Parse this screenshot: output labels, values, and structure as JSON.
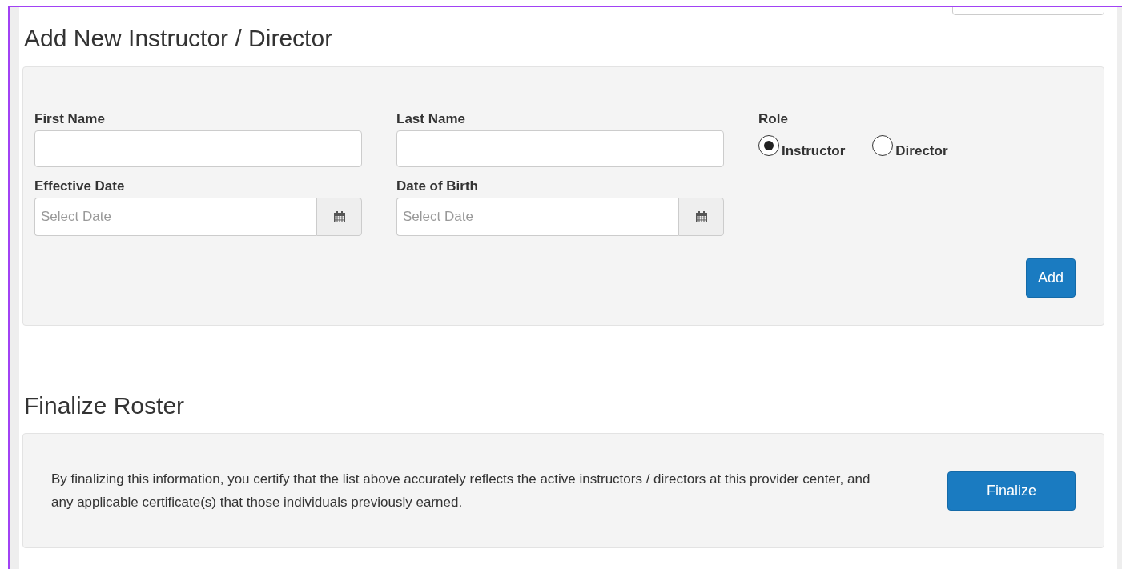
{
  "add_section": {
    "title": "Add New Instructor / Director",
    "fields": [
      {
        "kind": "text",
        "label": "First Name"
      },
      {
        "kind": "text",
        "label": "Last Name"
      },
      {
        "kind": "date",
        "label": "Effective Date",
        "placeholder": "Select Date"
      },
      {
        "kind": "date",
        "label": "Date of Birth",
        "placeholder": "Select Date"
      }
    ],
    "role": {
      "label": "Role",
      "options": [
        {
          "label": "Instructor",
          "selected": true
        },
        {
          "label": "Director",
          "selected": false
        }
      ]
    },
    "button": "Add"
  },
  "finalize_section": {
    "title": "Finalize Roster",
    "text": "By finalizing this information, you certify that the list above accurately reflects the active instructors / directors at this provider center, and any applicable certificate(s) that those individuals previously earned.",
    "button": "Finalize"
  }
}
